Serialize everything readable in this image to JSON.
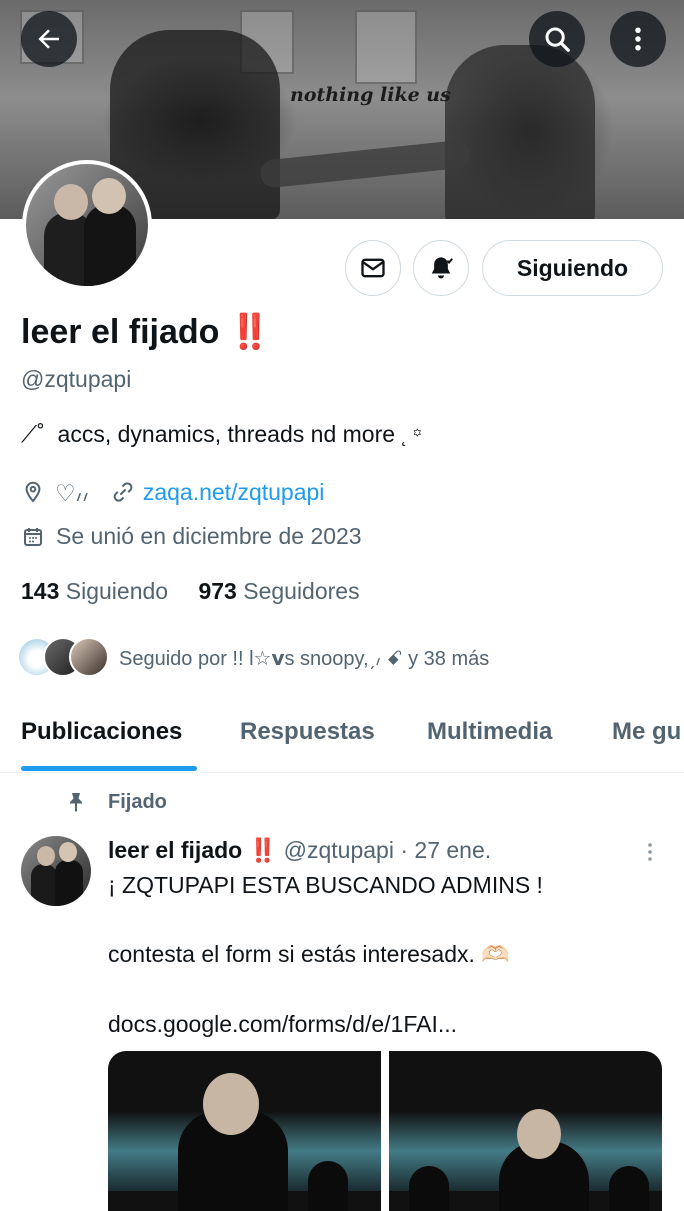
{
  "banner": {
    "caption": "nothing like us"
  },
  "profile": {
    "name": "leer el fijado",
    "name_emoji": "‼️",
    "handle": "@zqtupapi",
    "bio_prefix": "⟋˚",
    "bio": "accs, dynamics, threads nd more",
    "bio_suffix": "˛  ꙳",
    "location": "♡៸៸",
    "website": "zaqa.net/zqtupapi",
    "joined": "Se unió en diciembre de 2023",
    "following_count": "143",
    "following_label": "Siguiendo",
    "followers_count": "973",
    "followers_label": "Seguidores",
    "followed_by": "Seguido por !! l☆𝘃s snoopy,ˏ៸ ꗃ y 38 más"
  },
  "actions": {
    "follow_label": "Siguiendo"
  },
  "tabs": [
    {
      "label": "Publicaciones"
    },
    {
      "label": "Respuestas"
    },
    {
      "label": "Multimedia"
    },
    {
      "label": "Me gu"
    }
  ],
  "pinned_post": {
    "pinned_label": "Fijado",
    "author_name": "leer el fijado",
    "author_emoji": "‼️",
    "author_handle": "@zqtupapi",
    "separator": "·",
    "date": "27 ene.",
    "line1": "¡ ZQTUPAPI ESTA BUSCANDO ADMINS !",
    "line2": "contesta el form si estás interesadx. 🫶🏻",
    "link": "docs.google.com/forms/d/e/1FAI..."
  },
  "icons": {
    "back": "back-arrow-icon",
    "search": "search-icon",
    "more": "more-vertical-icon",
    "mail": "mail-icon",
    "bell": "notification-bell-icon",
    "location": "location-pin-icon",
    "link": "link-icon",
    "calendar": "calendar-icon",
    "pin": "pin-icon"
  },
  "colors": {
    "accent": "#1d9bf0",
    "text": "#0f1419",
    "secondary": "#536471"
  }
}
